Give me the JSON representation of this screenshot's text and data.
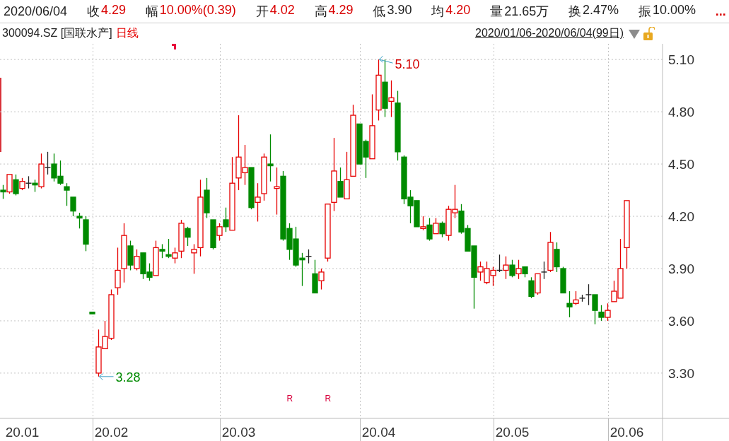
{
  "quote_bar": {
    "date": "2020/06/04",
    "fields": [
      {
        "label": "收",
        "value": "4.29",
        "color": "#d90000"
      },
      {
        "label": "幅",
        "value": "10.00%(0.39)",
        "color": "#d90000"
      },
      {
        "label": "开",
        "value": "4.02",
        "color": "#d90000"
      },
      {
        "label": "高",
        "value": "4.29",
        "color": "#d90000"
      },
      {
        "label": "低",
        "value": "3.90",
        "color": "#222222"
      },
      {
        "label": "均",
        "value": "4.20",
        "color": "#d90000"
      },
      {
        "label": "量",
        "value": "21.65万",
        "color": "#222222"
      },
      {
        "label": "换",
        "value": "2.47%",
        "color": "#222222"
      },
      {
        "label": "振",
        "value": "10.00%",
        "color": "#222222"
      }
    ],
    "more": "..."
  },
  "chart_header": {
    "symbol": "300094.SZ [国联水产]",
    "period": "日线",
    "range": "2020/01/06-2020/06/04(99日)"
  },
  "chart": {
    "chart_data": {
      "type": "candlestick",
      "grid": true,
      "categories": [
        null,
        null,
        null,
        "20.01",
        null,
        null,
        null,
        null,
        null,
        null,
        null,
        null,
        null,
        null,
        null,
        null,
        null,
        "20.02",
        null,
        null,
        null,
        null,
        null,
        null,
        null,
        null,
        null,
        null,
        null,
        null,
        null,
        null,
        null,
        null,
        null,
        null,
        null,
        "20.03",
        null,
        null,
        null,
        null,
        null,
        null,
        null,
        null,
        null,
        null,
        null,
        null,
        null,
        null,
        null,
        null,
        null,
        null,
        null,
        null,
        null,
        "20.04",
        null,
        null,
        null,
        null,
        null,
        null,
        null,
        null,
        null,
        null,
        null,
        null,
        null,
        null,
        null,
        null,
        null,
        null,
        null,
        null,
        "20.05",
        null,
        null,
        null,
        null,
        null,
        null,
        null,
        null,
        null,
        null,
        null,
        null,
        null,
        null,
        null,
        null,
        null,
        "20.06"
      ],
      "ohlc": [
        [
          4.35,
          4.38,
          4.3,
          4.34
        ],
        [
          4.34,
          4.44,
          4.33,
          4.44
        ],
        [
          4.41,
          4.44,
          4.32,
          4.33
        ],
        [
          4.36,
          4.42,
          4.35,
          4.4
        ],
        [
          4.39,
          4.43,
          4.36,
          4.39
        ],
        [
          4.39,
          4.41,
          4.34,
          4.38
        ],
        [
          4.37,
          4.56,
          4.36,
          4.5
        ],
        [
          4.48,
          4.57,
          4.44,
          4.48
        ],
        [
          4.5,
          4.56,
          4.4,
          4.42
        ],
        [
          4.43,
          4.52,
          4.38,
          4.39
        ],
        [
          4.37,
          4.39,
          4.26,
          4.35
        ],
        [
          4.31,
          4.31,
          4.2,
          4.23
        ],
        [
          4.2,
          4.22,
          4.13,
          4.19
        ],
        [
          4.18,
          4.2,
          4.0,
          4.04
        ],
        [
          3.65,
          3.65,
          3.64,
          3.64
        ],
        [
          3.3,
          3.55,
          3.28,
          3.45
        ],
        [
          3.44,
          3.6,
          3.44,
          3.51
        ],
        [
          3.5,
          3.78,
          3.49,
          3.75
        ],
        [
          3.79,
          4.02,
          3.75,
          3.89
        ],
        [
          3.9,
          4.16,
          3.82,
          4.09
        ],
        [
          4.03,
          4.06,
          3.89,
          3.92
        ],
        [
          3.9,
          4.01,
          3.89,
          3.97
        ],
        [
          3.99,
          3.99,
          3.84,
          3.87
        ],
        [
          3.88,
          3.93,
          3.83,
          3.85
        ],
        [
          3.86,
          4.06,
          3.86,
          4.02
        ],
        [
          4.01,
          4.04,
          3.96,
          4.0
        ],
        [
          3.98,
          4.07,
          3.96,
          3.97
        ],
        [
          3.96,
          4.02,
          3.93,
          3.99
        ],
        [
          4.0,
          4.18,
          3.96,
          4.16
        ],
        [
          4.13,
          4.14,
          4.03,
          4.08
        ],
        [
          3.99,
          4.04,
          3.87,
          4.01
        ],
        [
          4.02,
          4.41,
          3.97,
          4.31
        ],
        [
          4.35,
          4.42,
          4.19,
          4.22
        ],
        [
          4.18,
          4.18,
          4.01,
          4.02
        ],
        [
          4.09,
          4.16,
          4.06,
          4.14
        ],
        [
          4.18,
          4.25,
          4.11,
          4.14
        ],
        [
          4.12,
          4.54,
          4.12,
          4.39
        ],
        [
          4.42,
          4.78,
          4.35,
          4.54
        ],
        [
          4.45,
          4.61,
          4.38,
          4.48
        ],
        [
          4.48,
          4.48,
          4.24,
          4.25
        ],
        [
          4.28,
          4.39,
          4.17,
          4.31
        ],
        [
          4.33,
          4.56,
          4.29,
          4.54
        ],
        [
          4.5,
          4.67,
          4.4,
          4.49
        ],
        [
          4.36,
          4.48,
          4.21,
          4.37
        ],
        [
          4.43,
          4.46,
          4.06,
          4.07
        ],
        [
          4.13,
          4.16,
          3.95,
          4.01
        ],
        [
          4.07,
          4.14,
          3.91,
          3.92
        ],
        [
          3.96,
          3.99,
          3.8,
          3.95
        ],
        [
          3.97,
          4.01,
          3.93,
          3.97
        ],
        [
          3.87,
          3.95,
          3.76,
          3.76
        ],
        [
          3.83,
          3.9,
          3.78,
          3.88
        ],
        [
          3.96,
          4.27,
          3.94,
          4.27
        ],
        [
          4.28,
          4.65,
          4.23,
          4.46
        ],
        [
          4.4,
          4.48,
          4.31,
          4.31
        ],
        [
          4.3,
          4.57,
          4.3,
          4.41
        ],
        [
          4.43,
          4.84,
          4.43,
          4.78
        ],
        [
          4.73,
          4.73,
          4.5,
          4.5
        ],
        [
          4.63,
          4.64,
          4.42,
          4.54
        ],
        [
          4.53,
          4.9,
          4.53,
          4.72
        ],
        [
          4.81,
          5.1,
          4.75,
          5.01
        ],
        [
          4.97,
          5.1,
          4.77,
          4.82
        ],
        [
          4.86,
          4.98,
          4.77,
          4.88
        ],
        [
          4.85,
          4.92,
          4.52,
          4.57
        ],
        [
          4.54,
          4.55,
          4.27,
          4.3
        ],
        [
          4.31,
          4.35,
          4.16,
          4.26
        ],
        [
          4.29,
          4.29,
          4.14,
          4.14
        ],
        [
          4.13,
          4.2,
          4.12,
          4.14
        ],
        [
          4.15,
          4.19,
          4.06,
          4.07
        ],
        [
          4.1,
          4.19,
          4.1,
          4.16
        ],
        [
          4.16,
          4.17,
          4.08,
          4.1
        ],
        [
          4.09,
          4.26,
          4.06,
          4.24
        ],
        [
          4.22,
          4.38,
          4.19,
          4.24
        ],
        [
          4.23,
          4.27,
          4.1,
          4.11
        ],
        [
          4.13,
          4.15,
          4.0,
          4.0
        ],
        [
          4.03,
          4.03,
          3.67,
          3.85
        ],
        [
          3.88,
          3.94,
          3.83,
          3.91
        ],
        [
          3.82,
          3.94,
          3.81,
          3.9
        ],
        [
          3.86,
          3.91,
          3.8,
          3.89
        ],
        [
          3.89,
          3.98,
          3.88,
          3.89
        ],
        [
          3.89,
          3.97,
          3.84,
          3.92
        ],
        [
          3.92,
          3.95,
          3.85,
          3.86
        ],
        [
          3.87,
          3.95,
          3.84,
          3.9
        ],
        [
          3.91,
          3.91,
          3.85,
          3.87
        ],
        [
          3.83,
          3.85,
          3.73,
          3.74
        ],
        [
          3.76,
          3.87,
          3.75,
          3.87
        ],
        [
          3.88,
          3.94,
          3.84,
          3.88
        ],
        [
          3.89,
          4.11,
          3.88,
          4.05
        ],
        [
          4.01,
          4.05,
          3.88,
          3.91
        ],
        [
          3.9,
          3.91,
          3.76,
          3.76
        ],
        [
          3.7,
          3.77,
          3.62,
          3.68
        ],
        [
          3.7,
          3.77,
          3.69,
          3.72
        ],
        [
          3.73,
          3.75,
          3.71,
          3.73
        ],
        [
          3.75,
          3.81,
          3.69,
          3.75
        ],
        [
          3.75,
          3.75,
          3.58,
          3.66
        ],
        [
          3.65,
          3.69,
          3.6,
          3.62
        ],
        [
          3.62,
          3.7,
          3.6,
          3.66
        ],
        [
          3.71,
          3.83,
          3.71,
          3.77
        ],
        [
          3.73,
          4.07,
          3.73,
          3.9
        ],
        [
          4.02,
          4.29,
          3.9,
          4.29
        ]
      ],
      "ylim": [
        3.04,
        5.19
      ],
      "yticks": [
        {
          "value": 3.3,
          "label": "3.30"
        },
        {
          "value": 3.6,
          "label": "3.60"
        },
        {
          "value": 3.9,
          "label": "3.90"
        },
        {
          "value": 4.2,
          "label": "4.20"
        },
        {
          "value": 4.5,
          "label": "4.50"
        },
        {
          "value": 4.8,
          "label": "4.80"
        },
        {
          "value": 5.1,
          "label": "5.10"
        }
      ],
      "annotations": [
        "5.10",
        "3.28",
        "R",
        "R"
      ]
    }
  }
}
